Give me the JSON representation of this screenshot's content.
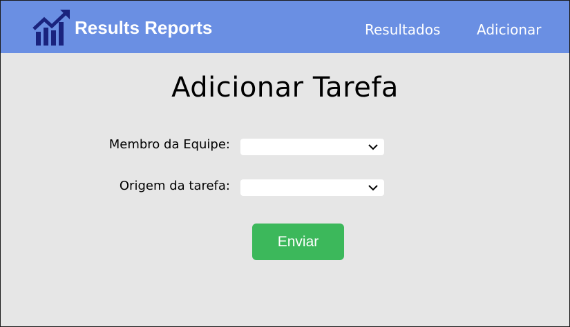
{
  "navbar": {
    "brand": "Results Reports",
    "logo_icon": "chart-growth-icon",
    "links": [
      {
        "label": "Resultados"
      },
      {
        "label": "Adicionar"
      }
    ]
  },
  "page": {
    "title": "Adicionar Tarefa"
  },
  "form": {
    "fields": [
      {
        "label": "Membro da Equipe:",
        "value": "",
        "icon": "chevron-down-icon"
      },
      {
        "label": "Origem da tarefa:",
        "value": "",
        "icon": "chevron-down-icon"
      }
    ],
    "submit_label": "Enviar"
  },
  "colors": {
    "navbar_bg": "#6a8fe3",
    "page_bg": "#e6e6e6",
    "logo": "#1a237e",
    "submit_bg": "#3cb85b"
  }
}
